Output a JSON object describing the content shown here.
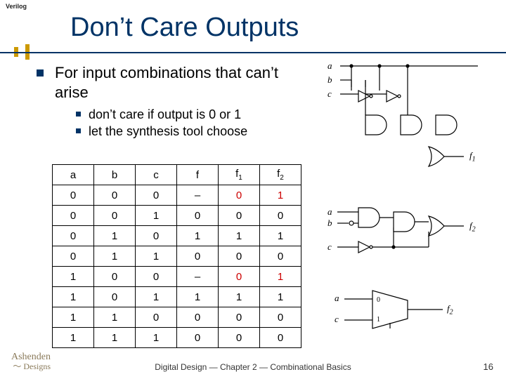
{
  "header_label": "Verilog",
  "title": "Don’t Care Outputs",
  "bullets": {
    "l1": "For input combinations that can’t arise",
    "l2a": "don’t care if output is 0 or 1",
    "l2b": "let the synthesis tool choose"
  },
  "table": {
    "headers": [
      "a",
      "b",
      "c",
      "f",
      "f1",
      "f2"
    ],
    "rows": [
      [
        "0",
        "0",
        "0",
        "–",
        "0",
        "1"
      ],
      [
        "0",
        "0",
        "1",
        "0",
        "0",
        "0"
      ],
      [
        "0",
        "1",
        "0",
        "1",
        "1",
        "1"
      ],
      [
        "0",
        "1",
        "1",
        "0",
        "0",
        "0"
      ],
      [
        "1",
        "0",
        "0",
        "–",
        "0",
        "1"
      ],
      [
        "1",
        "0",
        "1",
        "1",
        "1",
        "1"
      ],
      [
        "1",
        "1",
        "0",
        "0",
        "0",
        "0"
      ],
      [
        "1",
        "1",
        "1",
        "0",
        "0",
        "0"
      ]
    ],
    "red_cells": [
      [
        0,
        4
      ],
      [
        0,
        5
      ],
      [
        4,
        4
      ],
      [
        4,
        5
      ]
    ]
  },
  "diagram_labels": {
    "d1": {
      "a": "a",
      "b": "b",
      "c": "c",
      "out": "f1"
    },
    "d2": {
      "a": "a",
      "b": "b",
      "c": "c",
      "out": "f2"
    },
    "d3": {
      "a": "a",
      "c": "c",
      "zero": "0",
      "one": "1",
      "out": "f2"
    }
  },
  "footer": "Digital Design — Chapter 2 — Combinational Basics",
  "page": "16",
  "logo_top": "Ashenden",
  "logo_bot": "Designs"
}
